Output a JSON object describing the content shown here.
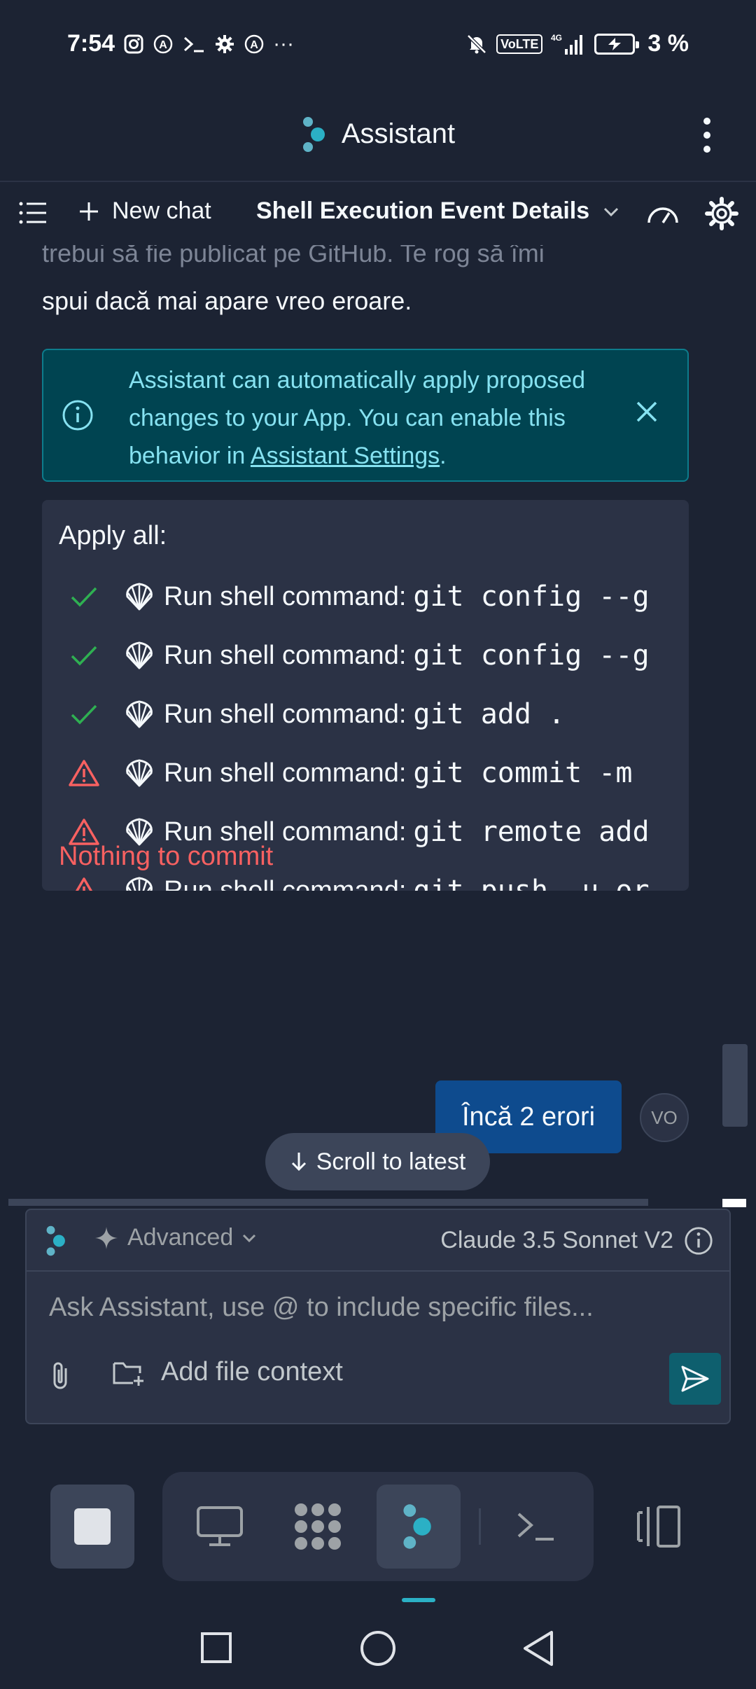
{
  "status_bar": {
    "time": "7:54",
    "left_icons": [
      "instagram-icon",
      "a-icon",
      "terminal-icon",
      "gear-icon",
      "a-icon",
      "more-icon"
    ],
    "more_glyph": "···",
    "network": "4G",
    "volte": "VoLTE",
    "battery": "3 %"
  },
  "app_header": {
    "title": "Assistant"
  },
  "toolbar": {
    "new_chat_label": "New chat",
    "chat_title": "Shell Execution Event Details"
  },
  "message": {
    "line1": "trebui să fie publicat pe GitHub. Te rog să îmi",
    "line2": "spui dacă mai apare vreo eroare."
  },
  "notice": {
    "text_before_link": "Assistant can automatically apply proposed changes to your App. You can enable this behavior in ",
    "link": "Assistant Settings",
    "text_after_link": "."
  },
  "apply_card": {
    "title": "Apply all:",
    "rows": [
      {
        "status": "success",
        "label": "Run shell command:",
        "command": "git config --global user.name"
      },
      {
        "status": "success",
        "label": "Run shell command:",
        "command": "git config --global user.email"
      },
      {
        "status": "success",
        "label": "Run shell command:",
        "command": "git add ."
      },
      {
        "status": "error",
        "label": "Run shell command:",
        "command": "git commit -m"
      },
      {
        "status": "error",
        "label": "Run shell command:",
        "command": "git remote add origin"
      },
      {
        "status": "error",
        "label": "Run shell command:",
        "command": "git push -u origin main"
      }
    ],
    "error_text": "Nothing to commit"
  },
  "user_message": {
    "text": "Încă 2 erori",
    "avatar_initials": "VO"
  },
  "scroll_latest_label": "Scroll to latest",
  "composer": {
    "mode": "Advanced",
    "model": "Claude 3.5 Sonnet V2",
    "placeholder": "Ask Assistant, use @ to include specific files...",
    "add_file_context": "Add file context"
  },
  "colors": {
    "background": "#1c2333",
    "surface": "#2b3245",
    "accent": "#2bb0c5",
    "success": "#2fb052",
    "error": "#f86161",
    "user_bubble": "#0e4b8e"
  }
}
